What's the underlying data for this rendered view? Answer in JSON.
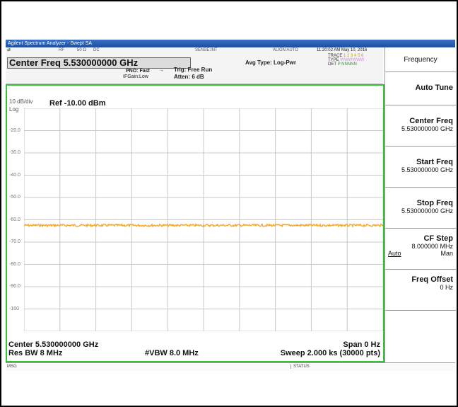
{
  "window": {
    "title": "Agilent Spectrum Analyzer - Swept SA"
  },
  "info": {
    "rf": "RF",
    "impedance": "50 Ω",
    "coupling": "DC",
    "sense": "SENSE:INT",
    "align": "ALIGN AUTO",
    "datetime": "11:20:02 AM May 10, 2016",
    "center_freq": "Center Freq 5.530000000 GHz",
    "pno": "PNO: Fast",
    "ifgain": "IFGain:Low",
    "trig": "Trig: Free Run",
    "atten": "Atten: 6 dB",
    "avg_type": "Avg Type: Log-Pwr",
    "trace_label": "TRACE",
    "trace_nums": "1 2 3 4 5 6",
    "type_label": "TYPE",
    "type_val": "WWWWWW",
    "det_label": "DET",
    "det_val": "P NNNNN"
  },
  "graph": {
    "scale": "10 dB/div",
    "ref": "Ref -10.00 dBm",
    "log": "Log",
    "y_labels": [
      "-20.0",
      "-30.0",
      "-40.0",
      "-50.0",
      "-60.0",
      "-70.0",
      "-80.0",
      "-90.0",
      "-100"
    ],
    "trace_level_dbm": -62.5,
    "ref_dbm": -10,
    "db_per_div": 10,
    "divisions": 10,
    "trace_color": "#f5a623",
    "grid_color": "#c8c8c8"
  },
  "bottom": {
    "center": "Center 5.530000000 GHz",
    "res_bw": "Res BW 8 MHz",
    "vbw": "#VBW 8.0 MHz",
    "span": "Span 0 Hz",
    "sweep": "Sweep  2.000 ks (30000 pts)"
  },
  "status": {
    "msg": "MSG",
    "status": "STATUS"
  },
  "softkeys": {
    "menu": "Frequency",
    "auto_tune": "Auto Tune",
    "center_freq": {
      "title": "Center Freq",
      "value": "5.530000000 GHz"
    },
    "start_freq": {
      "title": "Start Freq",
      "value": "5.530000000 GHz"
    },
    "stop_freq": {
      "title": "Stop Freq",
      "value": "5.530000000 GHz"
    },
    "cf_step": {
      "title": "CF Step",
      "value": "8.000000 MHz",
      "auto": "Auto",
      "man": "Man"
    },
    "freq_offset": {
      "title": "Freq Offset",
      "value": "0 Hz"
    }
  }
}
